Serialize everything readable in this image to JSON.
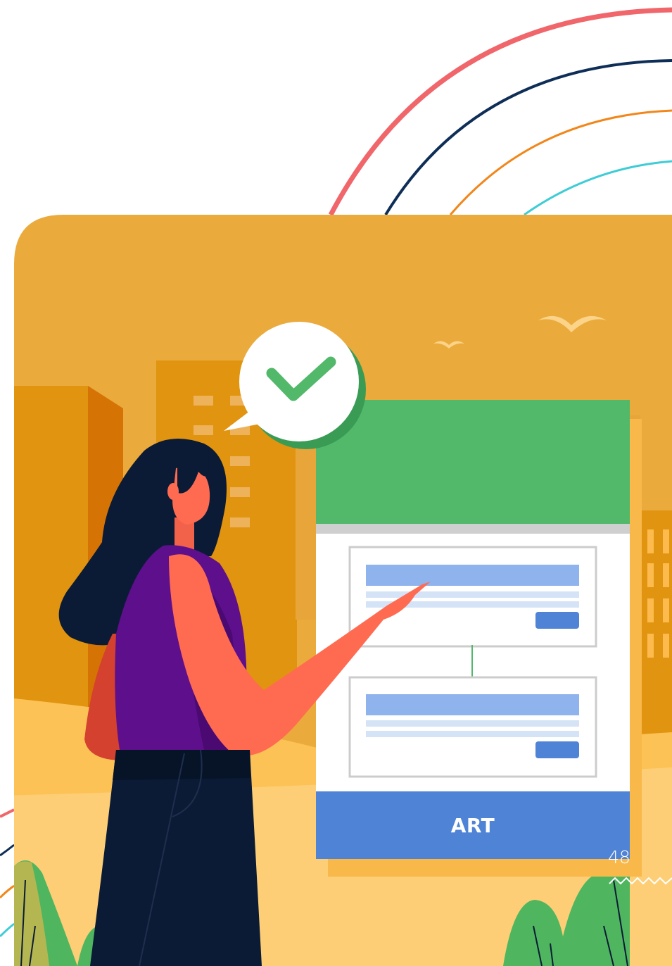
{
  "card": {
    "label": "ART"
  },
  "page": {
    "number": "48"
  },
  "colors": {
    "background": "#ffffff",
    "panel": "#EBAA3C",
    "form_header": "#52B86A",
    "button": "#4F83D6",
    "arc_red": "#F0666A",
    "arc_navy": "#0E2E57",
    "arc_orange": "#F2861A",
    "arc_cyan": "#3ECCD6"
  },
  "icons": [
    "checkmark-icon",
    "bird-icon",
    "speech-bubble-icon"
  ]
}
